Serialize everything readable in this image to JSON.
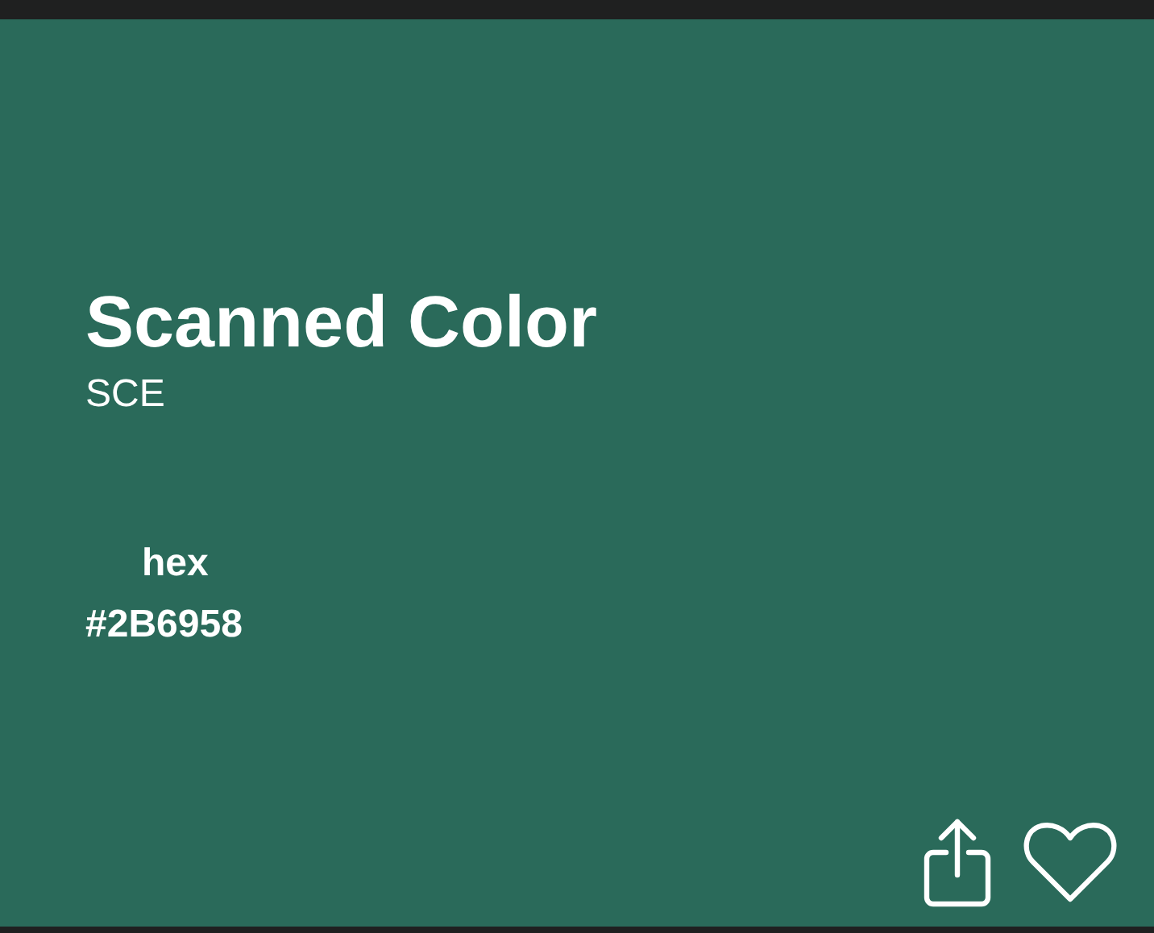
{
  "title": "Scanned Color",
  "subtitle": "SCE",
  "value_label": "hex",
  "value": "#2B6958",
  "favorited": false
}
